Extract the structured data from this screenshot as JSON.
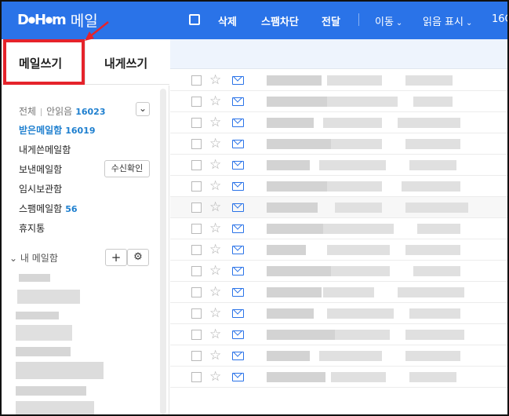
{
  "header": {
    "logo_mark": "D⦁H⦁m",
    "logo_text": "메일",
    "actions": {
      "delete": "삭제",
      "spam_block": "스팸차단",
      "forward": "전달",
      "move": "이동",
      "read_mark": "읽음 표시",
      "overflow": "16C"
    },
    "dropdown_glyph": "⌄"
  },
  "tabs": {
    "compose": "메일쓰기",
    "self_compose": "내게쓰기"
  },
  "sidebar": {
    "summary": {
      "all": "전체",
      "unread_label": "안읽음",
      "unread_count": "16023",
      "toggle_glyph": "⌄"
    },
    "folders": [
      {
        "label": "받은메일함",
        "count": "16019"
      },
      {
        "label": "내게쓴메일함",
        "count": ""
      },
      {
        "label": "보낸메일함",
        "count": ""
      },
      {
        "label": "임시보관함",
        "count": ""
      },
      {
        "label": "스팸메일함",
        "count": "56"
      },
      {
        "label": "휴지통",
        "count": ""
      }
    ],
    "receipt_button": "수신확인",
    "my_mailbox": {
      "label": "내 메일함",
      "add_glyph": "+",
      "settings_glyph": "⚙",
      "expand_glyph": "⌄"
    }
  },
  "list": {
    "star_glyph": "☆",
    "row_count": 15
  },
  "colors": {
    "brand": "#2a73e8",
    "count": "#1e7fcf",
    "annotation": "#e5232b"
  }
}
